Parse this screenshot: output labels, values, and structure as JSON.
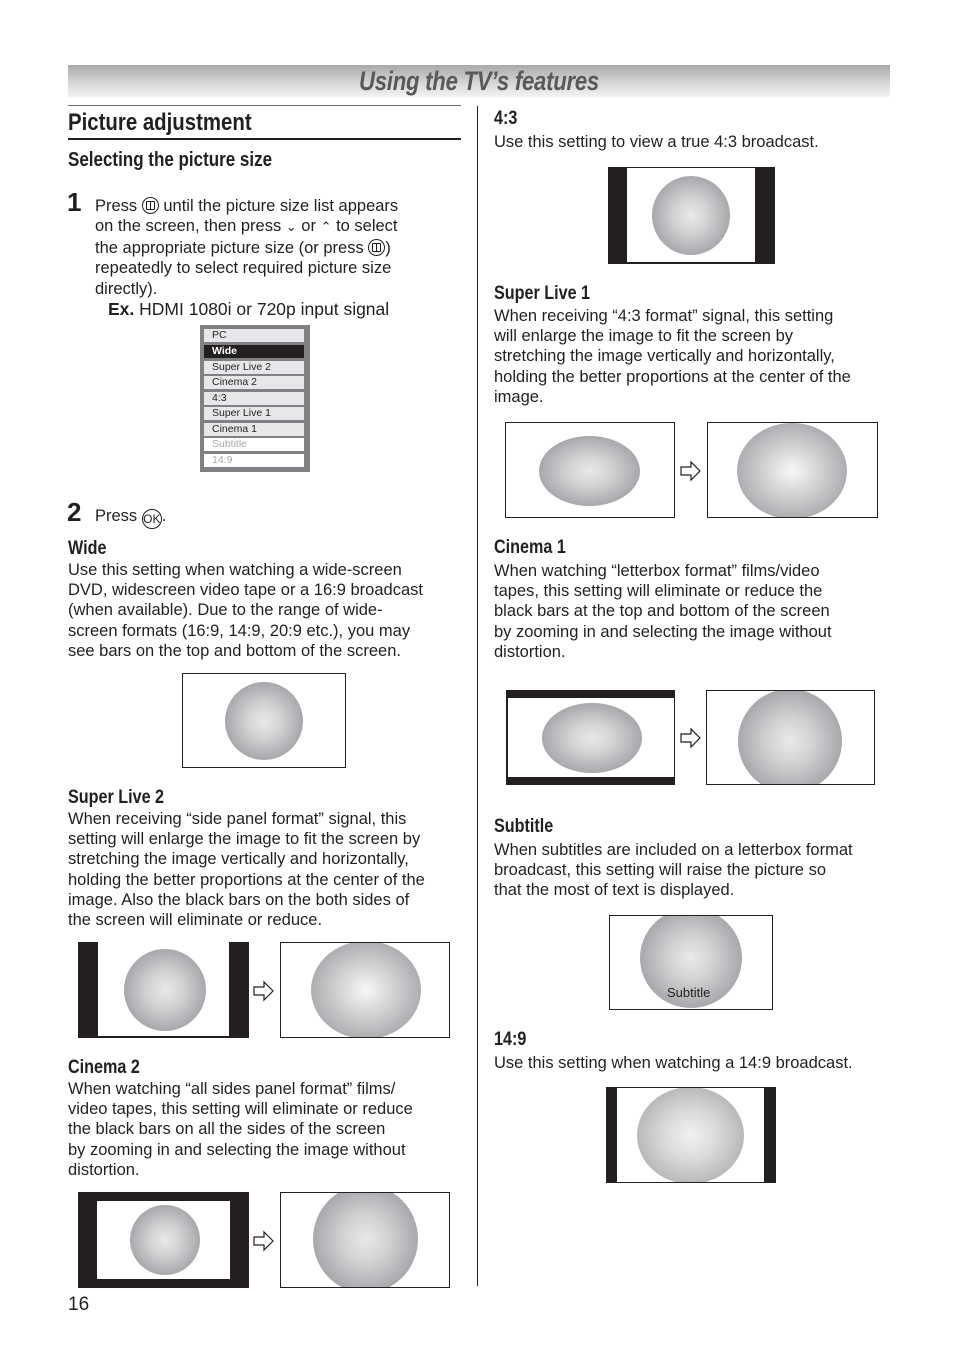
{
  "header": {
    "banner_title": "Using the TV’s features"
  },
  "section": {
    "title": "Picture adjustment",
    "subtitle": "Selecting the picture size"
  },
  "steps": [
    {
      "number": "1",
      "line1_a": "Press",
      "line1_b": "until the picture size list appears",
      "line2_a": "on the screen, then press",
      "line2_or": "or",
      "line2_b": "to select",
      "line3_a": "the appropriate picture size (or press",
      "line3_b": ")",
      "line4": "repeatedly to select required picture size",
      "line5": "directly).",
      "example_label": "Ex.",
      "example_text": "HDMI 1080i or 720p input signal"
    },
    {
      "number": "2",
      "text_a": "Press",
      "text_b": ".",
      "ok_label": "OK"
    }
  ],
  "icons": {
    "picture_size_button": "picture-size-button-icon",
    "down": "⌄",
    "up": "⌃"
  },
  "menu": {
    "items": [
      {
        "label": "PC",
        "state": "normal"
      },
      {
        "label": "Wide",
        "state": "selected"
      },
      {
        "label": "Super Live 2",
        "state": "normal"
      },
      {
        "label": "Cinema 2",
        "state": "normal"
      },
      {
        "label": "4:3",
        "state": "normal"
      },
      {
        "label": "Super Live 1",
        "state": "normal"
      },
      {
        "label": "Cinema 1",
        "state": "normal"
      },
      {
        "label": "Subtitle",
        "state": "disabled"
      },
      {
        "label": "14:9",
        "state": "disabled"
      }
    ]
  },
  "modes": {
    "wide": {
      "title": "Wide",
      "lines": [
        "Use this setting when watching a wide-screen",
        "DVD, widescreen video tape or a 16:9 broadcast",
        "(when available). Due to the range of wide-",
        "screen formats (16:9, 14:9, 20:9 etc.), you may",
        "see bars on the top and bottom of the screen."
      ]
    },
    "super_live_2": {
      "title": "Super Live 2",
      "lines": [
        "When receiving “side panel format” signal, this",
        "setting will enlarge the image to fit the screen by",
        "stretching the image vertically and horizontally,",
        "holding the better proportions at the center of the",
        "image. Also the black bars on the both sides of",
        "the screen will eliminate or reduce."
      ]
    },
    "cinema_2": {
      "title": "Cinema 2",
      "lines": [
        "When watching “all sides panel format” films/",
        "video tapes, this setting will eliminate or reduce",
        "the black bars on all the sides of the screen",
        "by zooming in and selecting the image without",
        "distortion."
      ]
    },
    "four_three": {
      "title": "4:3",
      "lines": [
        "Use this setting to view a true 4:3 broadcast."
      ]
    },
    "super_live_1": {
      "title": "Super Live 1",
      "lines": [
        "When receiving “4:3 format” signal, this setting",
        "will enlarge the image to fit the screen by",
        "stretching the image vertically and horizontally,",
        "holding the better proportions at the center of the",
        "image."
      ]
    },
    "cinema_1": {
      "title": "Cinema 1",
      "lines": [
        "When watching “letterbox format” films/video",
        "tapes, this setting will eliminate or reduce the",
        "black bars at the top and bottom of the screen",
        "by zooming in and selecting the image without",
        "distortion."
      ]
    },
    "subtitle": {
      "title": "Subtitle",
      "lines": [
        "When subtitles are included on a letterbox format",
        "broadcast, this setting will raise the picture so",
        "that the most of text is displayed."
      ],
      "illustration_caption": "Subtitle"
    },
    "fourteen_nine": {
      "title": "14:9",
      "lines": [
        "Use this setting when watching a 14:9 broadcast."
      ]
    }
  },
  "footer": {
    "page_number": "16"
  }
}
